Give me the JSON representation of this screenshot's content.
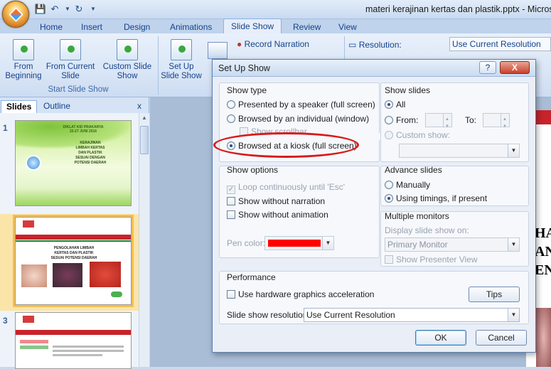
{
  "window": {
    "title": "materi kerajinan kertas dan plastik.pptx - Microso"
  },
  "quick_access": {
    "save_icon": "save-icon",
    "undo_icon": "undo-icon",
    "redo_icon": "redo-icon"
  },
  "ribbon_tabs": [
    "Home",
    "Insert",
    "Design",
    "Animations",
    "Slide Show",
    "Review",
    "View"
  ],
  "ribbon": {
    "from_beginning": "From Beginning",
    "from_current": "From Current Slide",
    "custom_show": "Custom Slide Show",
    "group_start": "Start Slide Show",
    "setup": "Set Up Slide Show",
    "record_narration": "Record Narration",
    "resolution_label": "Resolution:",
    "resolution_value": "Use Current Resolution"
  },
  "pane": {
    "tab_slides": "Slides",
    "tab_outline": "Outline",
    "close": "x",
    "slide_numbers": [
      "1",
      "2",
      "3"
    ],
    "slide1_lines": [
      "DIKLAT KID PRAKARYA",
      "22-27 JUNI 2016",
      "KERAJINAN",
      "LIMBAH KERTAS",
      "DAN PLASTIK",
      "SESUAI DENGAN",
      "POTENSI DAERAH"
    ],
    "slide2_title": "PENGOLAHAN LIMBAH",
    "slide2_line2": "KERTAS DAN PLASTIK",
    "slide2_line3": "SESUAI POTENSI DAERAH"
  },
  "dialog": {
    "title": "Set Up Show",
    "help": "?",
    "close": "X",
    "show_type": {
      "title": "Show type",
      "opt1": "Presented by a speaker (full screen)",
      "opt2": "Browsed by an individual (window)",
      "opt2_sub": "Show scrollbar",
      "opt3": "Browsed at a kiosk (full screen)"
    },
    "show_slides": {
      "title": "Show slides",
      "all": "All",
      "from": "From:",
      "to": "To:",
      "custom": "Custom show:"
    },
    "show_options": {
      "title": "Show options",
      "loop": "Loop continuously until 'Esc'",
      "no_narration": "Show without narration",
      "no_animation": "Show without animation",
      "pen_color": "Pen color:"
    },
    "advance": {
      "title": "Advance slides",
      "manually": "Manually",
      "timings": "Using timings, if present"
    },
    "monitors": {
      "title": "Multiple monitors",
      "display_on": "Display slide show on:",
      "monitor_value": "Primary Monitor",
      "presenter_view": "Show Presenter View"
    },
    "performance": {
      "title": "Performance",
      "hw_accel": "Use hardware graphics acceleration",
      "tips": "Tips",
      "resolution_label": "Slide show resolution:",
      "resolution_value": "Use Current Resolution"
    },
    "ok": "OK",
    "cancel": "Cancel"
  },
  "colors": {
    "pen_color": "#ff0000",
    "highlight": "#d91a1a",
    "slide_selected": "#f4be52"
  },
  "editor_text": [
    "HA",
    "AN",
    "EN"
  ]
}
